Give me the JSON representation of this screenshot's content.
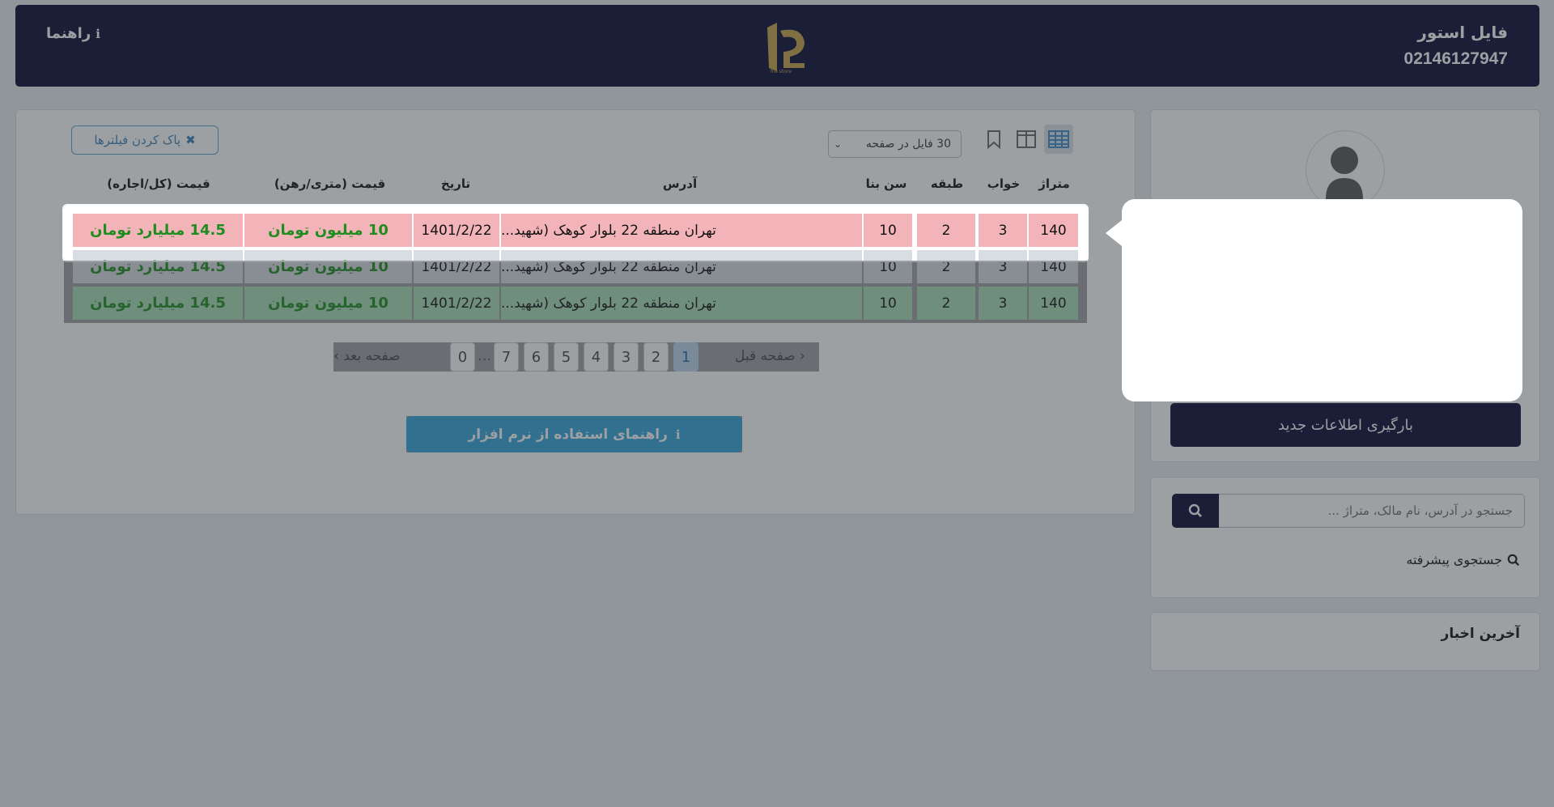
{
  "header": {
    "brand_name": "فایل استور",
    "phone": "02146127947",
    "help_label": "راهنما"
  },
  "toolbar": {
    "per_page_label": "30 فایل در صفحه",
    "clear_filters_label": "پاک کردن فیلترها",
    "icons": [
      "table-view-icon",
      "split-view-icon",
      "bookmark-icon"
    ]
  },
  "table": {
    "headers": [
      "متراژ",
      "خواب",
      "طبقه",
      "سن بنا",
      "آدرس",
      "تاریخ",
      "قیمت (متری/رهن)",
      "قیمت (کل/اجاره)"
    ],
    "rows": [
      {
        "area": "140",
        "beds": "3",
        "floor": "2",
        "age": "10",
        "address": "تهران منطقه 22 بلوار کوهک (شهید...",
        "date": "1401/2/22",
        "unit_price": "10 میلیون تومان",
        "total_price": "14.5 میلیارد تومان",
        "status": "red"
      },
      {
        "area": "140",
        "beds": "3",
        "floor": "2",
        "age": "10",
        "address": "تهران منطقه 22 بلوار کوهک (شهید...",
        "date": "1401/2/22",
        "unit_price": "10 میلیون تومان",
        "total_price": "14.5 میلیارد تومان",
        "status": "gray"
      },
      {
        "area": "140",
        "beds": "3",
        "floor": "2",
        "age": "10",
        "address": "تهران منطقه 22 بلوار کوهک (شهید...",
        "date": "1401/2/22",
        "unit_price": "10 میلیون تومان",
        "total_price": "14.5 میلیارد تومان",
        "status": "green"
      }
    ]
  },
  "pagination": {
    "prev_label": "‹ صفحه قبل",
    "next_label": "صفحه بعد ›",
    "pages": [
      "1",
      "2",
      "3",
      "4",
      "5",
      "6",
      "7",
      "0"
    ],
    "ellipsis": "...",
    "active_page": "1"
  },
  "guide_button_label": "راهنمای استفاده از نرم افزار",
  "sidebar": {
    "load_button_label": "بارگیری اطلاعات جدید",
    "search_placeholder": "جستجو در آدرس، نام مالک، متراژ ...",
    "advanced_search_label": "جستجوی پیشرفته",
    "news_title": "آخرین اخبار"
  },
  "colors": {
    "navy": "#040630",
    "row_red": "#f3b4b9",
    "row_green": "#a8ddb3",
    "price_green": "#1e8c1e",
    "guide_blue": "#31a3d8"
  }
}
